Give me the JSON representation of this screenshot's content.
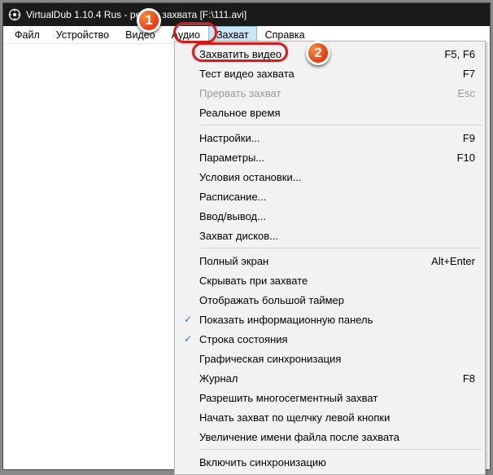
{
  "titlebar": {
    "title": "VirtualDub 1.10.4 Rus - режим захвата [F:\\111.avi]"
  },
  "menubar": {
    "items": [
      {
        "label": "Файл"
      },
      {
        "label": "Устройство"
      },
      {
        "label": "Видео"
      },
      {
        "label": "Аудио"
      },
      {
        "label": "Захват",
        "open": true
      },
      {
        "label": "Справка"
      }
    ]
  },
  "dropdown": {
    "rows": [
      {
        "label": "Захватить видео",
        "shortcut": "F5, F6"
      },
      {
        "label": "Тест видео захвата",
        "shortcut": "F7"
      },
      {
        "label": "Прервать захват",
        "shortcut": "Esc",
        "disabled": true
      },
      {
        "label": "Реальное время"
      },
      {
        "sep": true
      },
      {
        "label": "Настройки...",
        "shortcut": "F9"
      },
      {
        "label": "Параметры...",
        "shortcut": "F10"
      },
      {
        "label": "Условия остановки..."
      },
      {
        "label": "Расписание..."
      },
      {
        "label": "Ввод/вывод..."
      },
      {
        "label": "Захват дисков..."
      },
      {
        "sep": true
      },
      {
        "label": "Полный экран",
        "shortcut": "Alt+Enter"
      },
      {
        "label": "Скрывать при захвате"
      },
      {
        "label": "Отображать большой таймер"
      },
      {
        "label": "Показать информационную панель",
        "checked": true
      },
      {
        "label": "Строка состояния",
        "checked": true
      },
      {
        "label": "Графическая синхронизация"
      },
      {
        "label": "Журнал",
        "shortcut": "F8"
      },
      {
        "label": "Разрешить многосегментный захват"
      },
      {
        "label": "Начать захват по щелчку левой кнопки"
      },
      {
        "label": "Увеличение имени файла после захвата"
      },
      {
        "sep": true
      },
      {
        "label": "Включить синхронизацию"
      }
    ]
  },
  "annotations": {
    "badge1": "1",
    "badge2": "2"
  }
}
